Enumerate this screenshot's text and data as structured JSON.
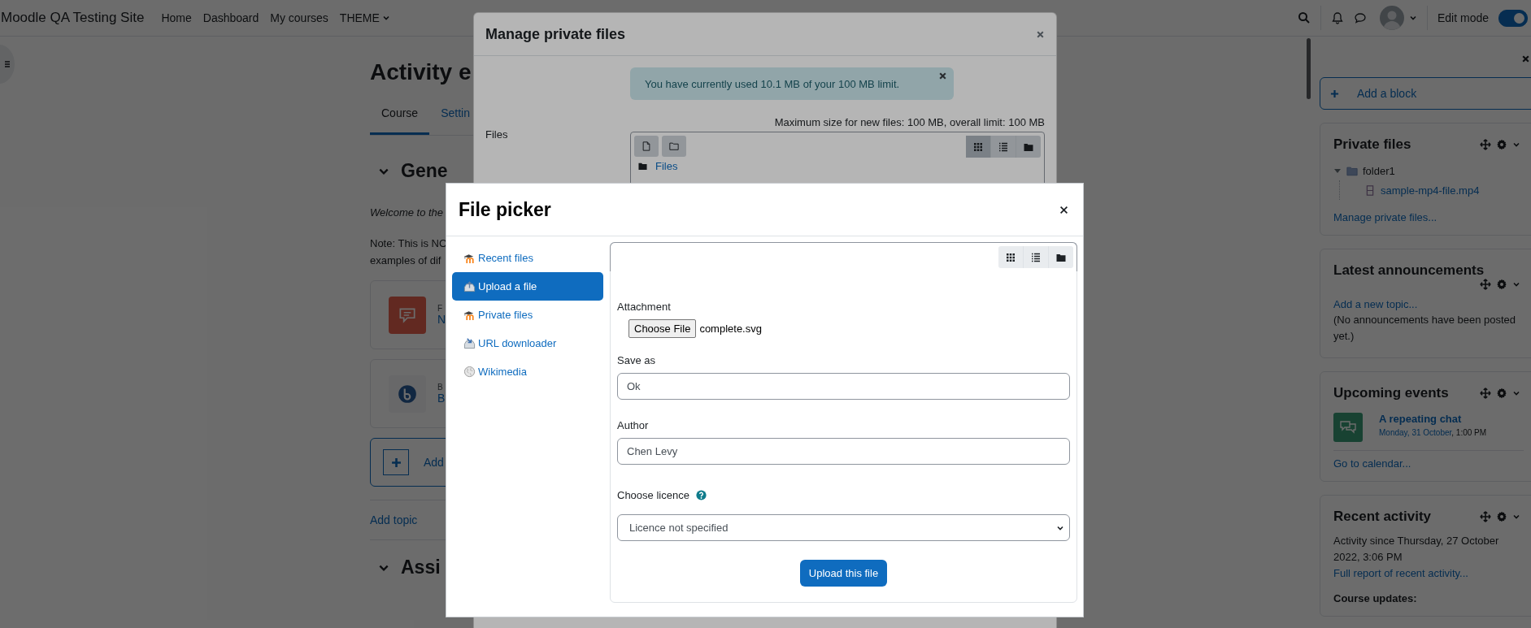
{
  "navbar": {
    "site_name": "Moodle QA Testing Site",
    "links": [
      {
        "label": "Home",
        "dropdown": false
      },
      {
        "label": "Dashboard",
        "dropdown": false
      },
      {
        "label": "My courses",
        "dropdown": false
      },
      {
        "label": "THEME",
        "dropdown": true
      }
    ],
    "edit_mode": {
      "label": "Edit mode",
      "on": true
    }
  },
  "course": {
    "title": "Activity e",
    "tabs": [
      {
        "label": "Course",
        "selected": true
      },
      {
        "label": "Settin",
        "selected": false
      }
    ],
    "general_section": {
      "title": "Gene",
      "expanded": true,
      "intro": "Welcome to the",
      "note_lines": [
        "Note: This is NO",
        "examples of dif"
      ],
      "activities": [
        {
          "kind": "forum",
          "type_label": "F",
          "name": "N"
        },
        {
          "kind": "bigbluebutton",
          "type_label": "B",
          "name": "B"
        }
      ],
      "add_activity": "Add"
    },
    "add_topic": "Add topic",
    "next_section": {
      "title": "Assi",
      "expanded": true
    }
  },
  "block_drawer": {
    "add_block": "Add a block",
    "blocks": [
      {
        "kind": "private_files",
        "title": "Private files",
        "tree": [
          {
            "name": "folder1",
            "expanded": true,
            "children": [
              {
                "name": "sample-mp4-file.mp4"
              }
            ]
          }
        ],
        "link": "Manage private files..."
      },
      {
        "kind": "announcements",
        "title": "Latest announcements",
        "link": "Add a new topic...",
        "text": "(No announcements have been posted yet.)"
      },
      {
        "kind": "events",
        "title": "Upcoming events",
        "events": [
          {
            "name": "A repeating chat",
            "date": "Monday, 31 October",
            "time": ", 1:00 PM"
          }
        ],
        "link": "Go to calendar..."
      },
      {
        "kind": "recent_activity",
        "title": "Recent activity",
        "text": "Activity since Thursday, 27 October 2022, 3:06 PM",
        "link": "Full report of recent activity...",
        "subheading": "Course updates:"
      }
    ]
  },
  "manage_modal": {
    "title": "Manage private files",
    "alert": "You have currently used 10.1 MB of your 100 MB limit.",
    "field_label": "Files",
    "limits": "Maximum size for new files: 100 MB, overall limit: 100 MB",
    "views": [
      {
        "kind": "grid",
        "selected": true
      },
      {
        "kind": "list",
        "selected": false
      },
      {
        "kind": "tree",
        "selected": false
      }
    ],
    "path": "Files"
  },
  "file_picker": {
    "title": "File picker",
    "repositories": [
      {
        "kind": "moodle",
        "label": "Recent files",
        "selected": false
      },
      {
        "kind": "upload",
        "label": "Upload a file",
        "selected": true
      },
      {
        "kind": "moodle",
        "label": "Private files",
        "selected": false
      },
      {
        "kind": "url",
        "label": "URL downloader",
        "selected": false
      },
      {
        "kind": "wikimedia",
        "label": "Wikimedia",
        "selected": false
      }
    ],
    "views": [
      {
        "kind": "grid",
        "selected": false
      },
      {
        "kind": "list",
        "selected": false
      },
      {
        "kind": "tree",
        "selected": false
      }
    ],
    "form": {
      "attachment_label": "Attachment",
      "choose_button": "Choose File",
      "chosen_file": "complete.svg",
      "save_as_label": "Save as",
      "save_as": "Ok",
      "author_label": "Author",
      "author": "Chen Levy",
      "licence_label": "Choose licence",
      "licence": "Licence not specified",
      "submit": "Upload this file"
    }
  }
}
